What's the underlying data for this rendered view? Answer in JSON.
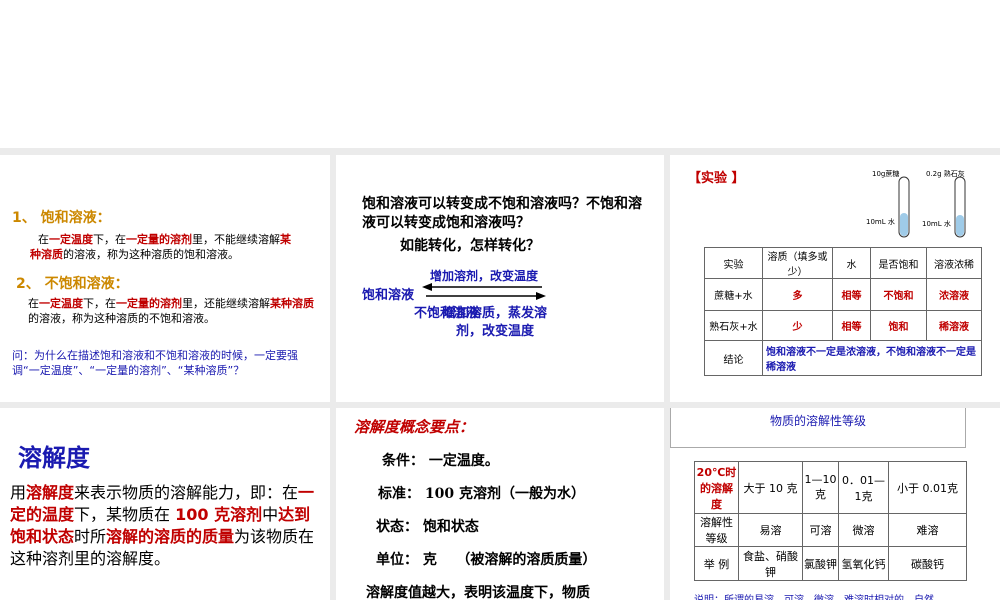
{
  "s1": {
    "h1": "1、 饱和溶液：",
    "p1": [
      {
        "t": "在"
      },
      {
        "t": "一定温度",
        "c": "red"
      },
      {
        "t": "下，在"
      },
      {
        "t": "一定量的溶剂",
        "c": "red"
      },
      {
        "t": "里，不能继续溶解"
      },
      {
        "t": "某种溶质",
        "c": "red"
      },
      {
        "t": "的溶液，称为这种溶质的饱和溶液。"
      }
    ],
    "h2": "2、 不饱和溶液：",
    "p2": [
      {
        "t": "在"
      },
      {
        "t": "一定温度",
        "c": "red"
      },
      {
        "t": "下，在"
      },
      {
        "t": "一定量的溶剂",
        "c": "red"
      },
      {
        "t": "里，还能继续溶解"
      },
      {
        "t": "某种溶质",
        "c": "red"
      },
      {
        "t": "的溶液，称为这种溶质的不饱和溶液。"
      }
    ],
    "q": "问：为什么在描述饱和溶液和不饱和溶液的时候，一定要强调“一定温度”、“一定量的溶剂”、“某种溶质”？"
  },
  "s2": {
    "question": "饱和溶液可以转变成不饱和溶液吗？不饱和溶液可以转变成饱和溶液吗？",
    "question2": "如能转化，怎样转化？",
    "left": "饱和溶液",
    "top_arrow": "增加溶剂，改变温度",
    "right": "不饱和溶液",
    "bottom_arrow": "增加溶质，蒸发溶剂，改变温度"
  },
  "s3": {
    "title": "【实验 】",
    "beaker1_top": "10g蔗糖",
    "beaker1_side": "10mL 水",
    "beaker2_top": "0.2g 熟石灰",
    "beaker2_side": "10mL 水",
    "headers": [
      "实验",
      "溶质（填多或少）",
      "水",
      "是否饱和",
      "溶液浓稀"
    ],
    "rows": [
      [
        "蔗糖+水",
        "多",
        "相等",
        "不饱和",
        "浓溶液"
      ],
      [
        "熟石灰+水",
        "少",
        "相等",
        "饱和",
        "稀溶液"
      ]
    ],
    "conclusion_label": "结论",
    "conclusion": "饱和溶液不一定是浓溶液，不饱和溶液不一定是稀溶液"
  },
  "s4": {
    "title": "溶解度",
    "body": [
      {
        "t": "用"
      },
      {
        "t": "溶解度",
        "c": "red"
      },
      {
        "t": "来表示物质的溶解能力，即：在"
      },
      {
        "t": "一定的温度",
        "c": "red"
      },
      {
        "t": "下，某物质在 "
      },
      {
        "t": "100 克溶剂",
        "c": "red"
      },
      {
        "t": "中"
      },
      {
        "t": "达到饱和状态",
        "c": "red"
      },
      {
        "t": "时所"
      },
      {
        "t": "溶解的溶质的质量",
        "c": "red"
      },
      {
        "t": "为该物质在这种溶剂里的溶解度。"
      }
    ]
  },
  "s5": {
    "title": "溶解度概念要点：",
    "items": [
      "条件： 一定温度。",
      "标准： 100 克溶剂（一般为水）",
      "状态： 饱和状态",
      "单位： 克    （被溶解的溶质质量）",
      "溶解度值越大，表明该温度下，物质"
    ]
  },
  "s6": {
    "title": "物质的溶解性等级",
    "header_label": "20℃时的溶解度",
    "ranges": [
      "大于 10 克",
      "1—10克",
      "0．01—1克",
      "小于 0.01克"
    ],
    "level_label": "溶解性等级",
    "levels": [
      "易溶",
      "可溶",
      "微溶",
      "难溶"
    ],
    "example_label": "举 例",
    "examples": [
      "食盐、硝酸钾",
      "氯酸钾",
      "氢氧化钙",
      "碳酸钙"
    ],
    "note": "说明：所谓的易溶、可溶、微溶、难溶时相对的，自然"
  }
}
